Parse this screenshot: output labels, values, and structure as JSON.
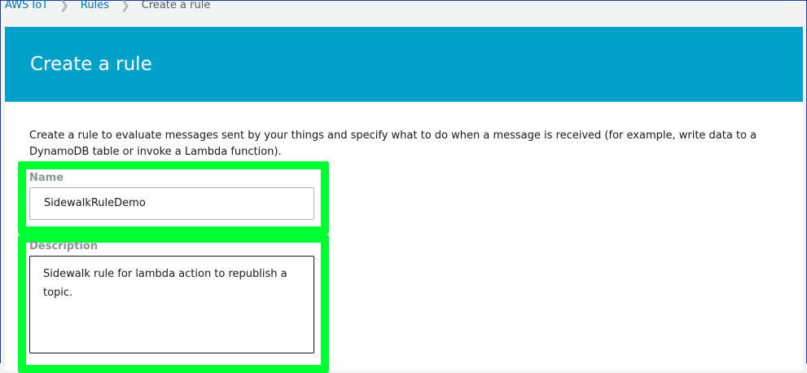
{
  "breadcrumb": {
    "items": [
      "AWS IoT",
      "Rules"
    ],
    "current": "Create a rule"
  },
  "header": {
    "title": "Create a rule"
  },
  "intro": "Create a rule to evaluate messages sent by your things and specify what to do when a message is received (for example, write data to a DynamoDB table or invoke a Lambda function).",
  "form": {
    "name_label": "Name",
    "name_value": "SidewalkRuleDemo",
    "description_label": "Description",
    "description_value": "Sidewalk rule for lambda action to republish a topic."
  },
  "colors": {
    "banner": "#00a1c9",
    "highlight": "#00ff33",
    "link": "#0073bb"
  }
}
